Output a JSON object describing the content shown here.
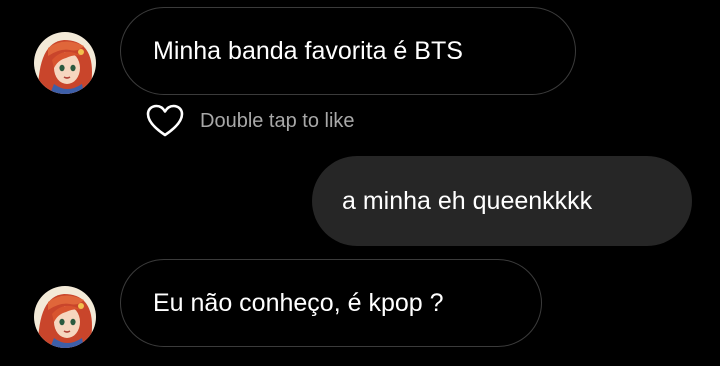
{
  "messages": [
    {
      "sender": "other",
      "text": "Minha banda favorita é BTS"
    },
    {
      "sender": "me",
      "text": "a minha eh queenkkkk"
    },
    {
      "sender": "other",
      "text": "Eu não conheço, é kpop ?"
    }
  ],
  "like_hint": {
    "icon": "heart-outline-icon",
    "label": "Double tap to like"
  },
  "colors": {
    "background": "#000000",
    "incoming_border": "#3b3b3b",
    "outgoing_bubble": "#262626",
    "hint_text": "#a8a8a8"
  }
}
